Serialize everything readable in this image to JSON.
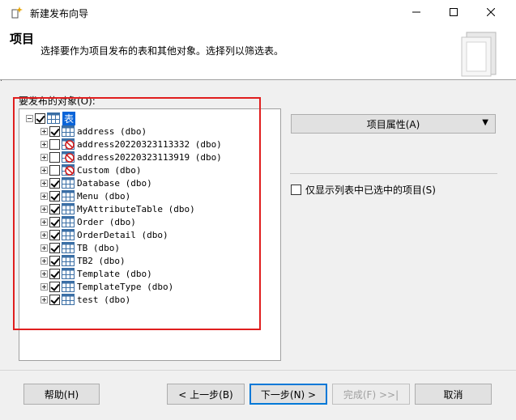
{
  "window": {
    "title": "新建发布向导",
    "controls": {
      "minimize_icon": "minimize-icon",
      "maximize_icon": "maximize-icon",
      "close_icon": "close-icon"
    }
  },
  "header": {
    "title": "项目",
    "subtitle": "选择要作为项目发布的表和其他对象。选择列以筛选表。"
  },
  "objects_label": "要发布的对象(O):",
  "tree": {
    "root": "表",
    "items": [
      {
        "label": "address (dbo)",
        "checked": true,
        "excluded": false
      },
      {
        "label": "address20220323113332 (dbo)",
        "checked": false,
        "excluded": true
      },
      {
        "label": "address20220323113919 (dbo)",
        "checked": false,
        "excluded": true
      },
      {
        "label": "Custom (dbo)",
        "checked": false,
        "excluded": true
      },
      {
        "label": "Database (dbo)",
        "checked": true,
        "excluded": false
      },
      {
        "label": "Menu (dbo)",
        "checked": true,
        "excluded": false
      },
      {
        "label": "MyAttributeTable (dbo)",
        "checked": true,
        "excluded": false
      },
      {
        "label": "Order (dbo)",
        "checked": true,
        "excluded": false
      },
      {
        "label": "OrderDetail (dbo)",
        "checked": true,
        "excluded": false
      },
      {
        "label": "TB (dbo)",
        "checked": true,
        "excluded": false
      },
      {
        "label": "TB2 (dbo)",
        "checked": true,
        "excluded": false
      },
      {
        "label": "Template (dbo)",
        "checked": true,
        "excluded": false
      },
      {
        "label": "TemplateType (dbo)",
        "checked": true,
        "excluded": false
      },
      {
        "label": "test (dbo)",
        "checked": true,
        "excluded": false
      }
    ]
  },
  "article_properties_label": "项目属性(A)",
  "only_selected_label": "仅显示列表中已选中的项目(S)",
  "buttons": {
    "help": "帮助(H)",
    "back": "< 上一步(B)",
    "next": "下一步(N) >",
    "finish": "完成(F) >>|",
    "cancel": "取消"
  },
  "colors": {
    "highlight": "#e01e1e",
    "selection": "#0a64d8",
    "accent": "#0078d7"
  }
}
